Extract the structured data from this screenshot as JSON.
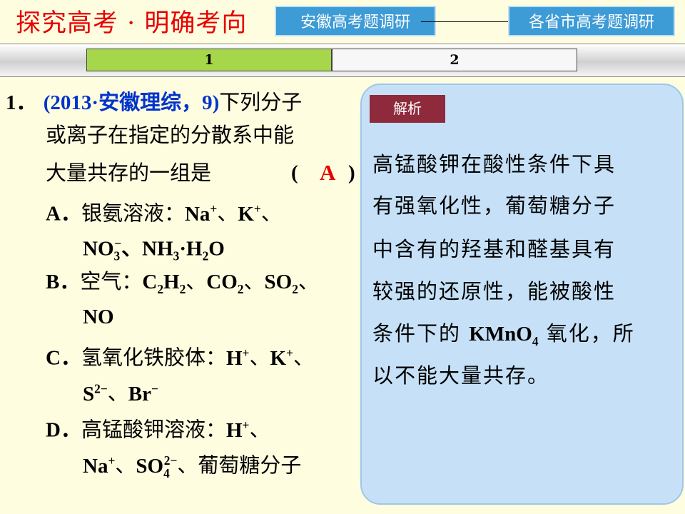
{
  "header": {
    "title": "探究高考 · 明确考向",
    "btn_anhui": "安徽高考题调研",
    "btn_provinces": "各省市高考题调研"
  },
  "tabs": [
    "1",
    "2"
  ],
  "question": {
    "number": "1．",
    "source": "(2013·安徽理综，9)",
    "stem": [
      "下列分子",
      "或离子在指定的分散系中能",
      "大量共存的一组是"
    ],
    "bracket_open": "(",
    "answer": "A",
    "bracket_close": ")",
    "A": {
      "letter": "A．",
      "prefix": "银氨溶液："
    },
    "B": {
      "letter": "B．",
      "prefix": "空气："
    },
    "C": {
      "letter": "C．",
      "prefix": "氢氧化铁胶体："
    },
    "D": {
      "letter": "D．",
      "prefix": "高锰酸钾溶液：",
      "tail": "、葡萄糖分子"
    }
  },
  "analysis": {
    "label": "解析",
    "lines": [
      "高锰酸钾在酸性条件下具",
      "有强氧化性，葡萄糖分子",
      "中含有的羟基和醛基具有",
      "较强的还原性，能被酸性"
    ],
    "line5_prefix": "条件下的",
    "line5_suffix": "氧化，所",
    "line6": "以不能大量共存。"
  }
}
